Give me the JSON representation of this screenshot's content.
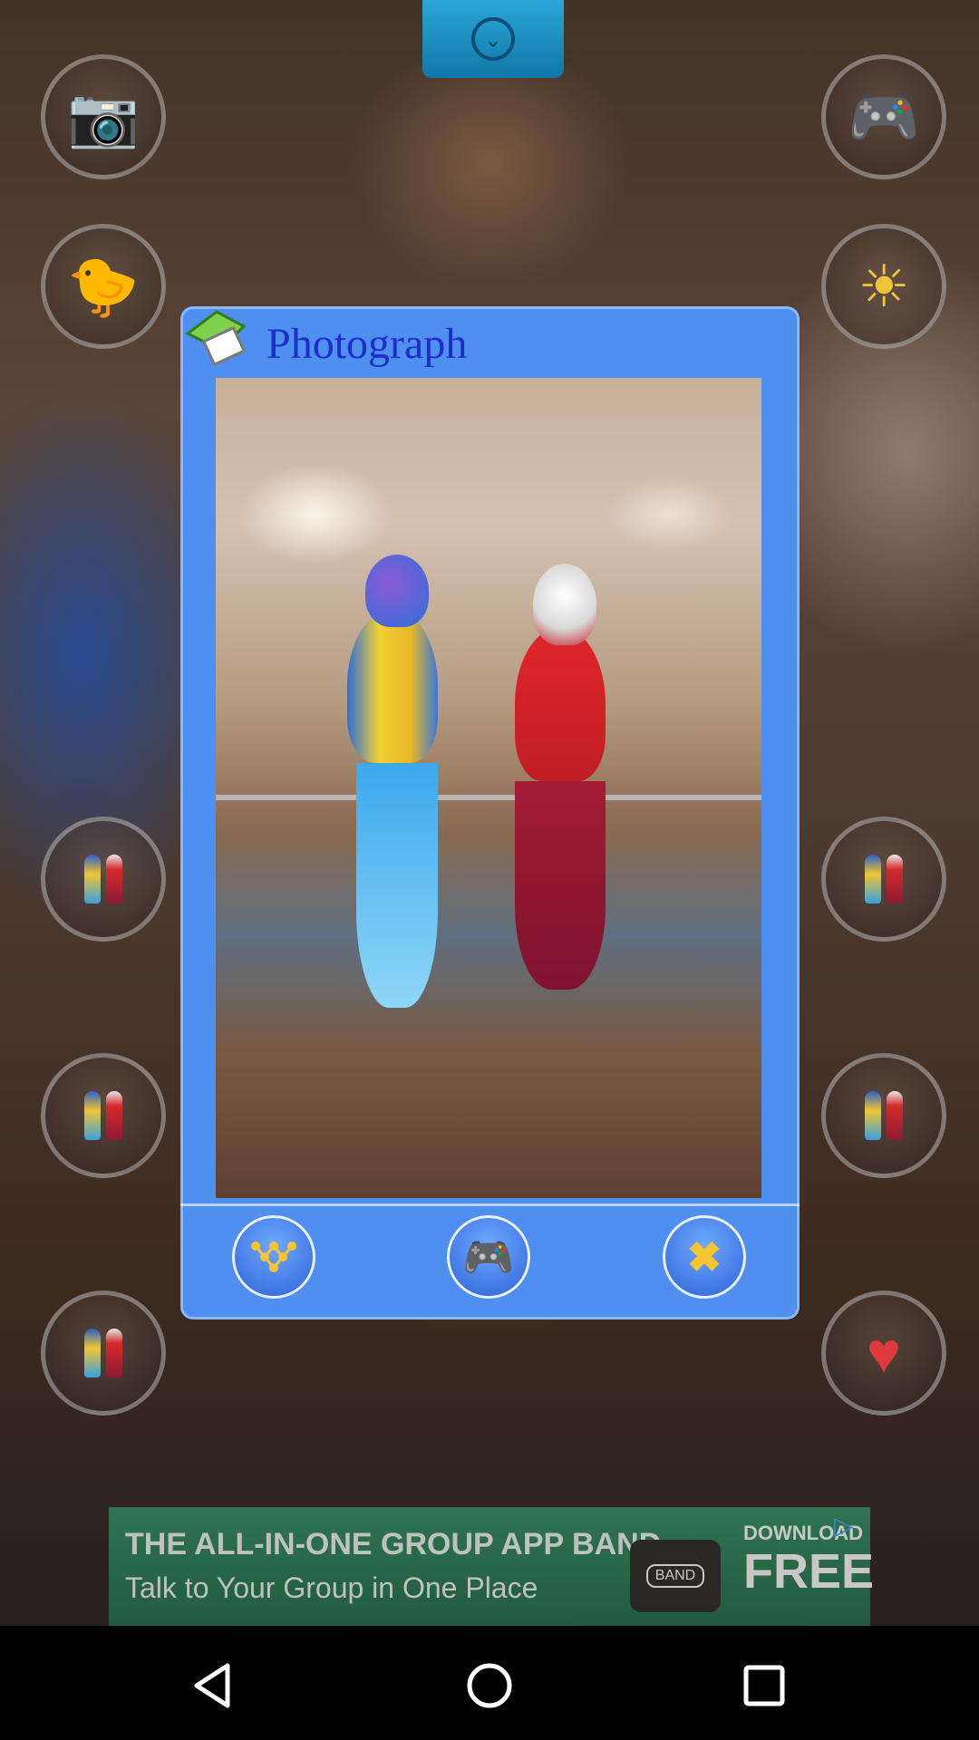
{
  "dialog": {
    "title": "Photograph",
    "icons": [
      "photo-share-icon",
      "share-network-icon",
      "gamepad-icon",
      "close-icon"
    ]
  },
  "side_buttons": {
    "left": [
      "camera-icon",
      "chick-sticker-icon",
      "parrot-thumbnail-icon",
      "parrot-thumbnail-icon",
      "parrot-thumbnail-icon"
    ],
    "right": [
      "gamepad-icon",
      "sun-icon",
      "parrot-thumbnail-icon",
      "parrot-thumbnail-icon",
      "heart-icon"
    ]
  },
  "ad": {
    "headline": "THE ALL-IN-ONE GROUP APP BAND",
    "subline": "Talk to Your Group in One Place",
    "badge": "BAND",
    "cta_top": "DOWNLOAD",
    "cta_main": "FREE"
  },
  "navbar": {
    "icons": [
      "back-icon",
      "home-icon",
      "recent-apps-icon"
    ]
  }
}
